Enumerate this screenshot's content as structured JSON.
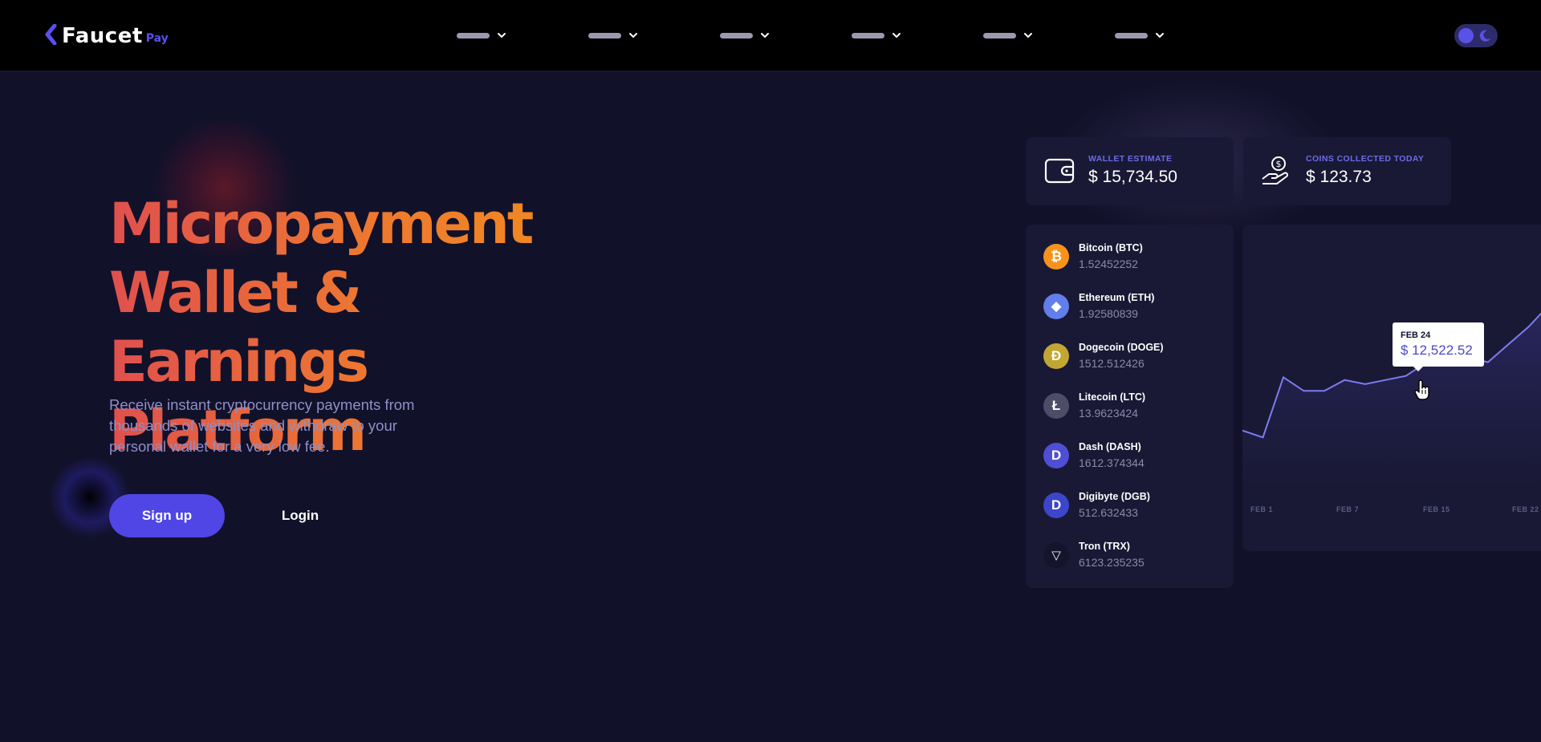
{
  "header": {
    "logo": {
      "name": "Faucet",
      "suffix": "Pay"
    },
    "nav_items": [
      "",
      "",
      "",
      "",
      "",
      ""
    ],
    "theme_toggle": "dark"
  },
  "hero": {
    "title_lines": [
      "Micropayment",
      "Wallet & Earnings",
      "Platform"
    ],
    "subtitle": "Receive instant cryptocurrency payments from thousands of websites and withdraw to your personal wallet for a very low fee.",
    "signup_label": "Sign up",
    "login_label": "Login"
  },
  "stats": {
    "wallet": {
      "label": "WALLET ESTIMATE",
      "value": "$ 15,734.50",
      "icon": "wallet-icon"
    },
    "coins": {
      "label": "COINS COLLECTED TODAY",
      "value": "$ 123.73",
      "icon": "hand-coin-icon"
    }
  },
  "coins": [
    {
      "name": "Bitcoin (BTC)",
      "amount": "1.52452252",
      "symbol": "₿",
      "color": "#f7931a",
      "icon": "bitcoin-icon"
    },
    {
      "name": "Ethereum (ETH)",
      "amount": "1.92580839",
      "symbol": "◆",
      "color": "#627eea",
      "icon": "ethereum-icon"
    },
    {
      "name": "Dogecoin (DOGE)",
      "amount": "1512.512426",
      "symbol": "Ð",
      "color": "#c2a633",
      "icon": "dogecoin-icon"
    },
    {
      "name": "Litecoin (LTC)",
      "amount": "13.9623424",
      "symbol": "Ł",
      "color": "#4d4d67",
      "icon": "litecoin-icon"
    },
    {
      "name": "Dash (DASH)",
      "amount": "1612.374344",
      "symbol": "D",
      "color": "#4f4fd6",
      "icon": "dash-icon"
    },
    {
      "name": "Digibyte (DGB)",
      "amount": "512.632433",
      "symbol": "D",
      "color": "#3c46c8",
      "icon": "digibyte-icon"
    },
    {
      "name": "Tron (TRX)",
      "amount": "6123.235235",
      "symbol": "▽",
      "color": "#14142c",
      "icon": "tron-icon"
    }
  ],
  "chart_data": {
    "type": "area",
    "x_ticks": [
      "FEB 1",
      "FEB 7",
      "FEB 15",
      "FEB 22"
    ],
    "y_relative": [
      0.43,
      0.38,
      0.82,
      0.72,
      0.72,
      0.8,
      0.77,
      0.8,
      0.83,
      0.93,
      1.02,
      0.97,
      0.93,
      1.06,
      1.19,
      1.35,
      1.31
    ],
    "tooltip": {
      "date": "FEB 24",
      "value": "$ 12,522.52"
    },
    "line_color": "#7d7cf0",
    "fill_color": "#2a2862"
  }
}
